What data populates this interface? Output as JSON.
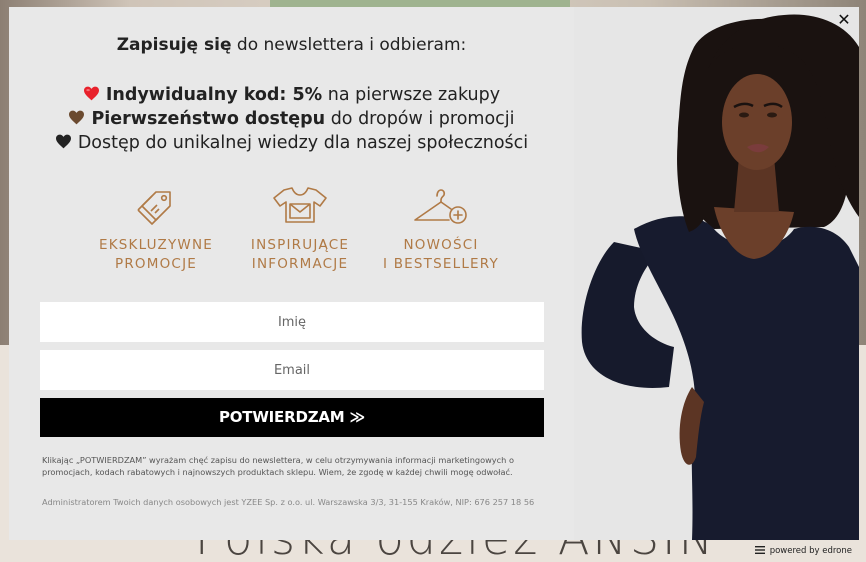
{
  "background": {
    "heading": "Polska odzież ANSIN"
  },
  "popup": {
    "headline": {
      "bold": "Zapisuję się",
      "rest": " do newslettera  i odbieram:"
    },
    "benefits": [
      {
        "icon": "red-heart-icon",
        "color": "#e8212b",
        "bold": "Indywidualny kod: 5%",
        "rest": " na pierwsze zakupy"
      },
      {
        "icon": "brown-heart-icon",
        "color": "#6b4a2f",
        "bold": "Pierwszeństwo dostępu",
        "rest": " do dropów i promocji"
      },
      {
        "icon": "black-heart-icon",
        "color": "#222222",
        "bold": "",
        "rest": "Dostęp do unikalnej wiedzy dla naszej społeczności"
      }
    ],
    "features": [
      {
        "icon": "price-tags-icon",
        "line1": "EKSKLUZYWNE",
        "line2": "PROMOCJE"
      },
      {
        "icon": "tshirt-envelope-icon",
        "line1": "INSPIRUJĄCE",
        "line2": "INFORMACJE"
      },
      {
        "icon": "hanger-plus-icon",
        "line1": "NOWOŚCI",
        "line2": "I BESTSELLERY"
      }
    ],
    "accent_color": "#b07a46",
    "name_placeholder": "Imię",
    "email_placeholder": "Email",
    "submit_label": "POTWIERDZAM ≫",
    "consent_text": "Klikając „POTWIERDZAM” wyrażam chęć zapisu do newslettera, w celu otrzymywania  informacji marketingowych o promocjach, kodach rabatowych i najnowszych produktach sklepu. Wiem, że zgodę w każdej chwili mogę odwołać.",
    "admin_text": "Administratorem Twoich danych osobowych jest YZEE Sp. z o.o. ul. Warszawska 3/3, 31-155 Kraków, NIP: 676 257 18 56",
    "close_label": "✕"
  },
  "footer": {
    "powered_by": "powered by edrone"
  }
}
